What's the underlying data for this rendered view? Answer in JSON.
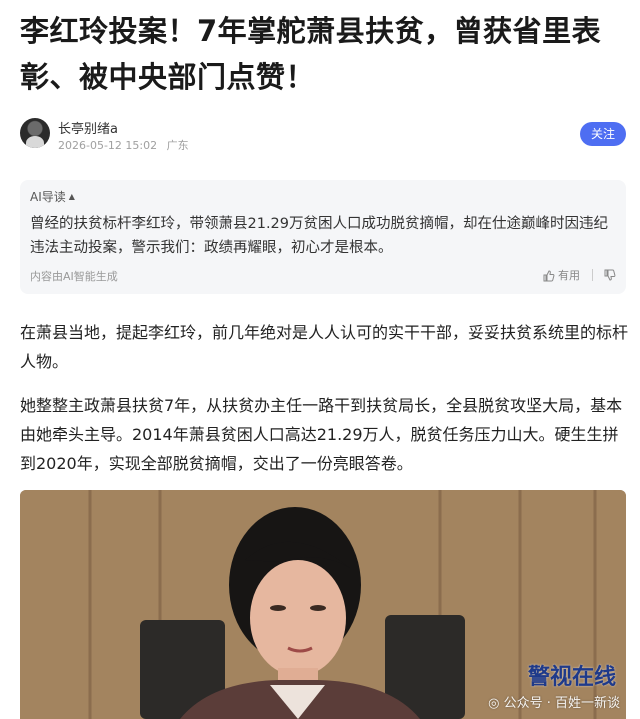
{
  "article": {
    "title": "李红玲投案！7年掌舵萧县扶贫，曾获省里表彰、被中央部门点赞！"
  },
  "author": {
    "name": "长亭别绪a",
    "datetime": "2026-05-12 15:02",
    "location": "广东",
    "follow_label": "关注"
  },
  "ai_summary": {
    "header": "AI导读",
    "text": "曾经的扶贫标杆李红玲，带领萧县21.29万贫困人口成功脱贫摘帽，却在仕途巅峰时因违纪违法主动投案，警示我们：政绩再耀眼，初心才是根本。",
    "note": "内容由AI智能生成",
    "useful_label": "有用"
  },
  "paragraphs": [
    "在萧县当地，提起李红玲，前几年绝对是人人认可的实干干部，妥妥扶贫系统里的标杆人物。",
    "她整整主政萧县扶贫7年，从扶贫办主任一路干到扶贫局长，全县脱贫攻坚大局，基本由她牵头主导。2014年萧县贫困人口高达21.29万人，脱贫任务压力山大。硬生生拼到2020年，实现全部脱贫摘帽，交出了一份亮眼答卷。"
  ],
  "photo": {
    "watermark": "公众号 · 百姓一新谈",
    "brand": "警视在线"
  },
  "colors": {
    "accent": "#4e6ef2",
    "summary_bg": "#f5f6f8"
  },
  "icons": [
    "caret-up-icon",
    "thumbs-up-icon",
    "thumbs-down-icon",
    "wechat-icon"
  ]
}
